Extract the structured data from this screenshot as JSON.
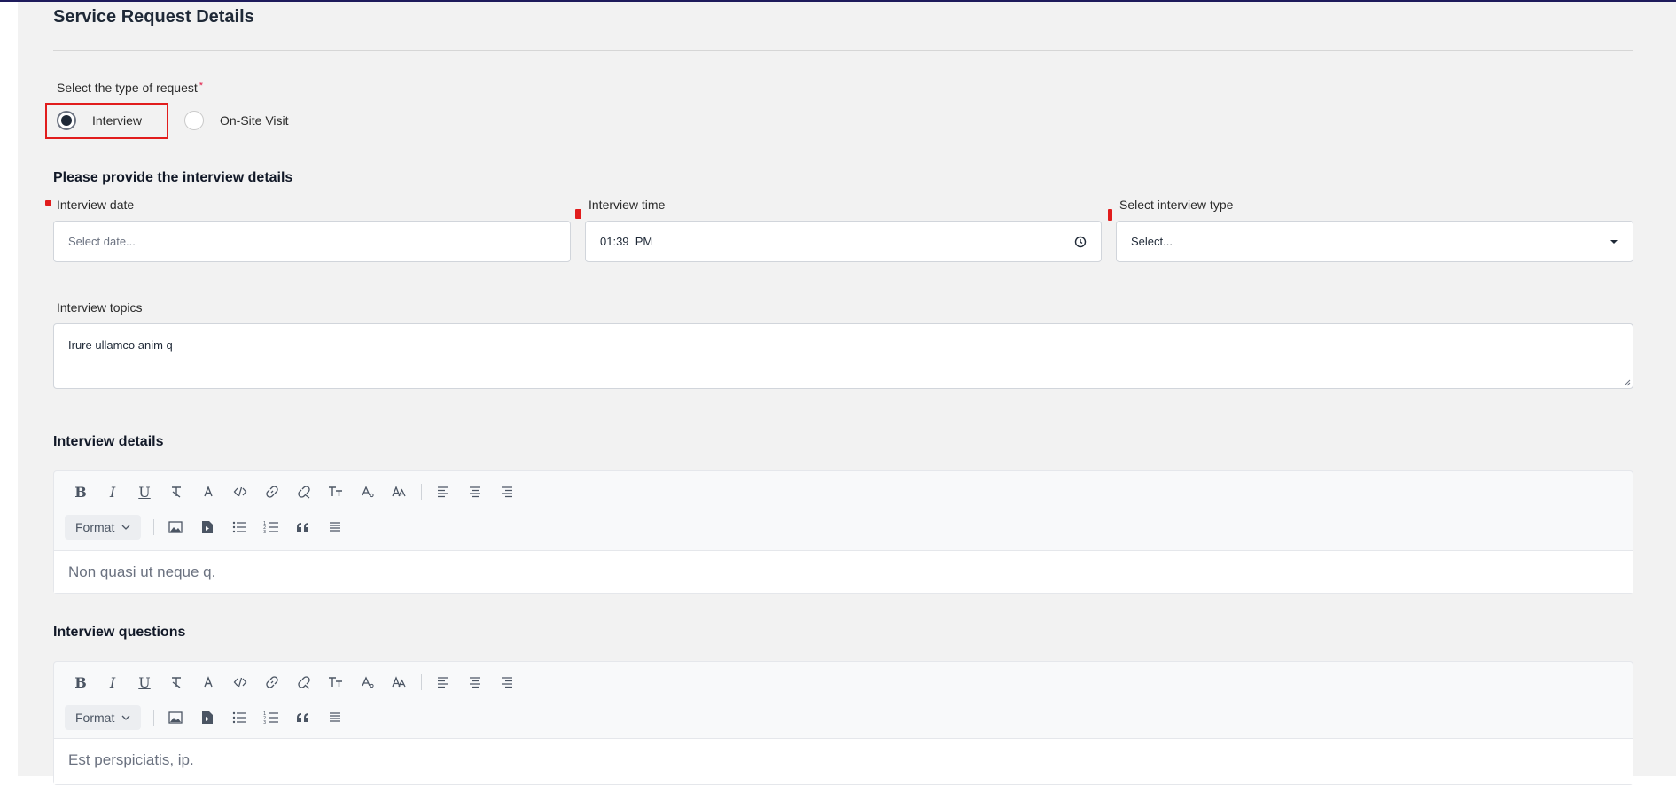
{
  "page": {
    "title": "Service Request Details"
  },
  "request_type": {
    "label": "Select the type of request",
    "required_mark": "*",
    "options": [
      {
        "label": "Interview",
        "selected": true
      },
      {
        "label": "On-Site Visit",
        "selected": false
      }
    ]
  },
  "interview_details_heading": "Please provide the interview details",
  "fields": {
    "date": {
      "label": "Interview date",
      "placeholder": "Select date...",
      "value": ""
    },
    "time": {
      "label": "Interview time",
      "value": "01:39  PM"
    },
    "type": {
      "label": "Select interview type",
      "value": "Select..."
    },
    "topics": {
      "label": "Interview topics",
      "value": "Irure ullamco anim q"
    }
  },
  "editors": [
    {
      "title": "Interview details",
      "format_label": "Format",
      "content": "Non quasi ut neque q."
    },
    {
      "title": "Interview questions",
      "format_label": "Format",
      "content": "Est perspiciatis, ip."
    }
  ],
  "toolbar_icons_row1": [
    "bold-icon",
    "italic-icon",
    "underline-icon",
    "clear-format-icon",
    "text-color-icon",
    "code-icon",
    "link-icon",
    "unlink-icon",
    "font-size-icon",
    "subscript-icon",
    "superscript-icon",
    "align-left-icon",
    "align-center-icon",
    "align-right-icon"
  ],
  "toolbar_icons_row2": [
    "image-icon",
    "video-icon",
    "bullet-list-icon",
    "numbered-list-icon",
    "blockquote-icon",
    "horizontal-rule-icon"
  ],
  "colors": {
    "accent_dark": "#1e1b5c",
    "highlight_red": "#e11d1d",
    "panel_bg": "#f2f2f2"
  }
}
